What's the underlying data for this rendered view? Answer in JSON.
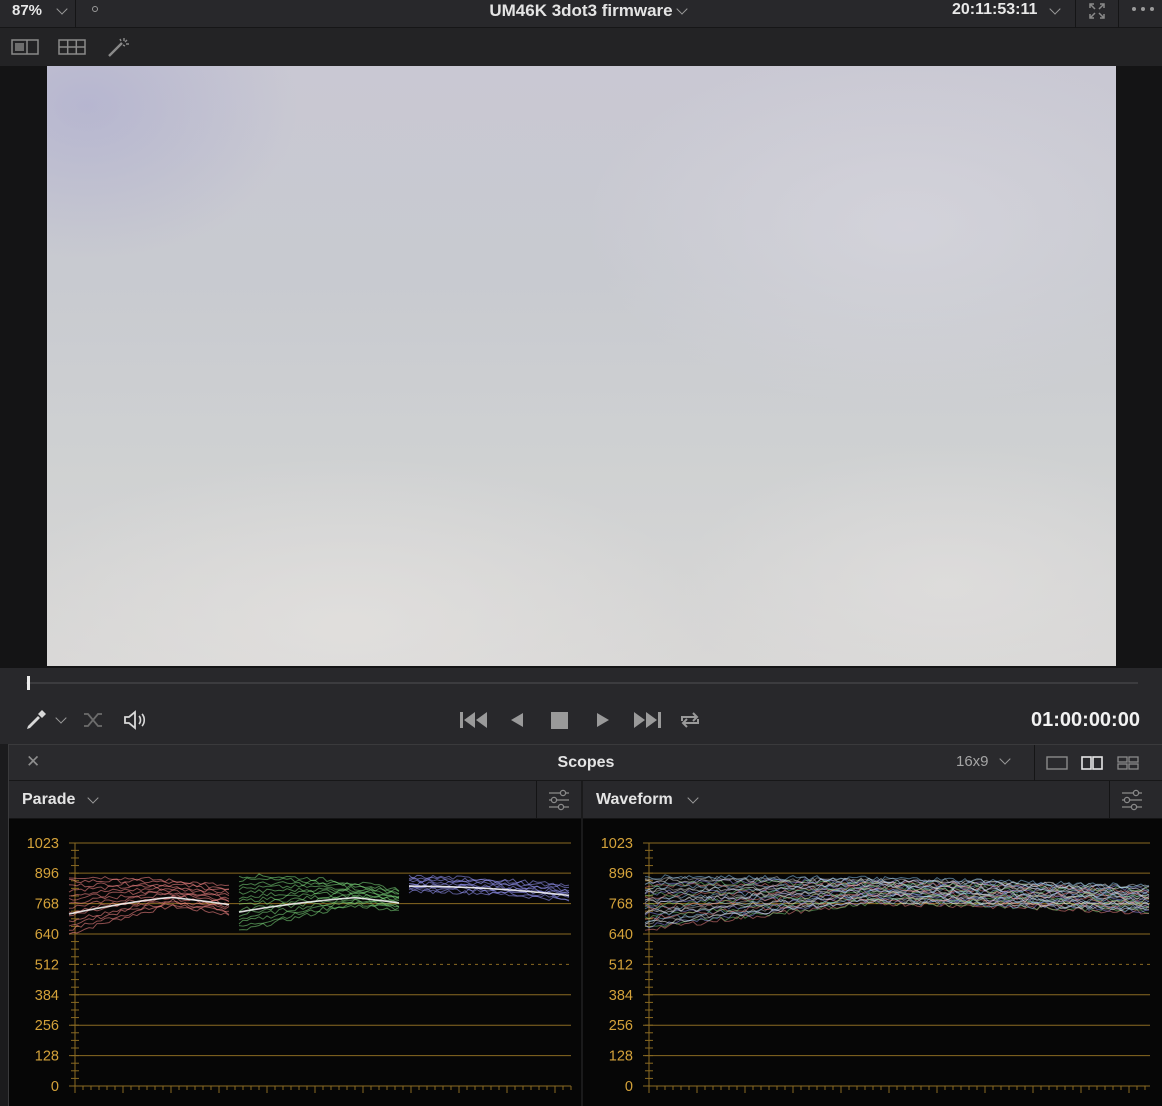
{
  "top_bar": {
    "zoom": "87%",
    "clip_title": "UM46K 3dot3 firmware",
    "timecode": "20:11:53:11"
  },
  "transport": {
    "timecode": "01:00:00:00"
  },
  "scopes": {
    "title": "Scopes",
    "aspect": "16x9",
    "left_panel": {
      "name": "Parade",
      "y_ticks": [
        "1023",
        "896",
        "768",
        "640",
        "512",
        "384",
        "256",
        "128",
        "0"
      ]
    },
    "right_panel": {
      "name": "Waveform",
      "y_ticks": [
        "1023",
        "896",
        "768",
        "640",
        "512",
        "384",
        "256",
        "128",
        "0"
      ]
    }
  },
  "colors": {
    "accent_tick": "#d4a23a",
    "red_trace": "#ff8a8a",
    "green_trace": "#7fe07f",
    "blue_trace": "#9a9aff"
  }
}
